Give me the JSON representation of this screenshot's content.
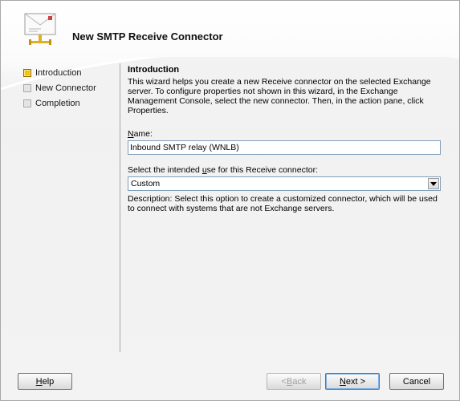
{
  "header": {
    "title": "New SMTP Receive Connector",
    "icon": "connector-envelope-icon"
  },
  "nav": {
    "items": [
      {
        "label": "Introduction",
        "state": "active"
      },
      {
        "label": "New Connector",
        "state": "pending"
      },
      {
        "label": "Completion",
        "state": "pending"
      }
    ]
  },
  "main": {
    "section_title": "Introduction",
    "intro_text": "This wizard helps you create a new Receive connector on the selected Exchange server. To configure properties not shown in this wizard, in the Exchange Management Console, select the new connector. Then, in the action pane, click Properties.",
    "name_label_access": "N",
    "name_label_rest": "ame:",
    "name_value": "Inbound SMTP relay (WNLB)",
    "use_label_pre": "Select the intended ",
    "use_label_access": "u",
    "use_label_post": "se for this Receive connector:",
    "use_selected": "Custom",
    "description": "Description: Select this option to create a customized connector, which will be used to connect with systems that are not Exchange servers."
  },
  "buttons": {
    "help_access": "H",
    "help_rest": "elp",
    "back_pre": "< ",
    "back_access": "B",
    "back_rest": "ack",
    "next_access": "N",
    "next_rest": "ext >",
    "cancel": "Cancel"
  },
  "colors": {
    "active_marker": "#f5c20a",
    "input_border": "#7f9db9"
  }
}
